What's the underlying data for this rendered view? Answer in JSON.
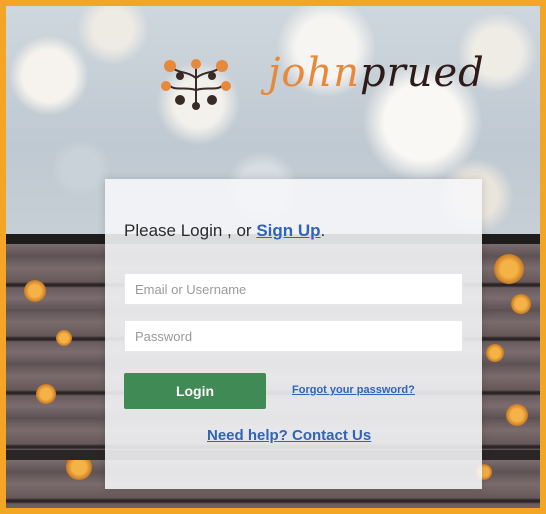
{
  "brand": {
    "name_part1": "john",
    "name_part2": "prued",
    "logo_icon": "decorative-tree-icon"
  },
  "login": {
    "heading_text": "Please Login , or ",
    "signup_link": "Sign Up",
    "heading_suffix": ".",
    "email_placeholder": "Email or Username",
    "password_placeholder": "Password",
    "login_button": "Login",
    "forgot_link": "Forgot your password?",
    "help_link": "Need help? Contact Us"
  },
  "colors": {
    "frame_border": "#f2a623",
    "link": "#2f64b8",
    "login_button": "#3f8a55",
    "brand_orange": "#e6893b",
    "brand_dark": "#2d1b1a"
  }
}
